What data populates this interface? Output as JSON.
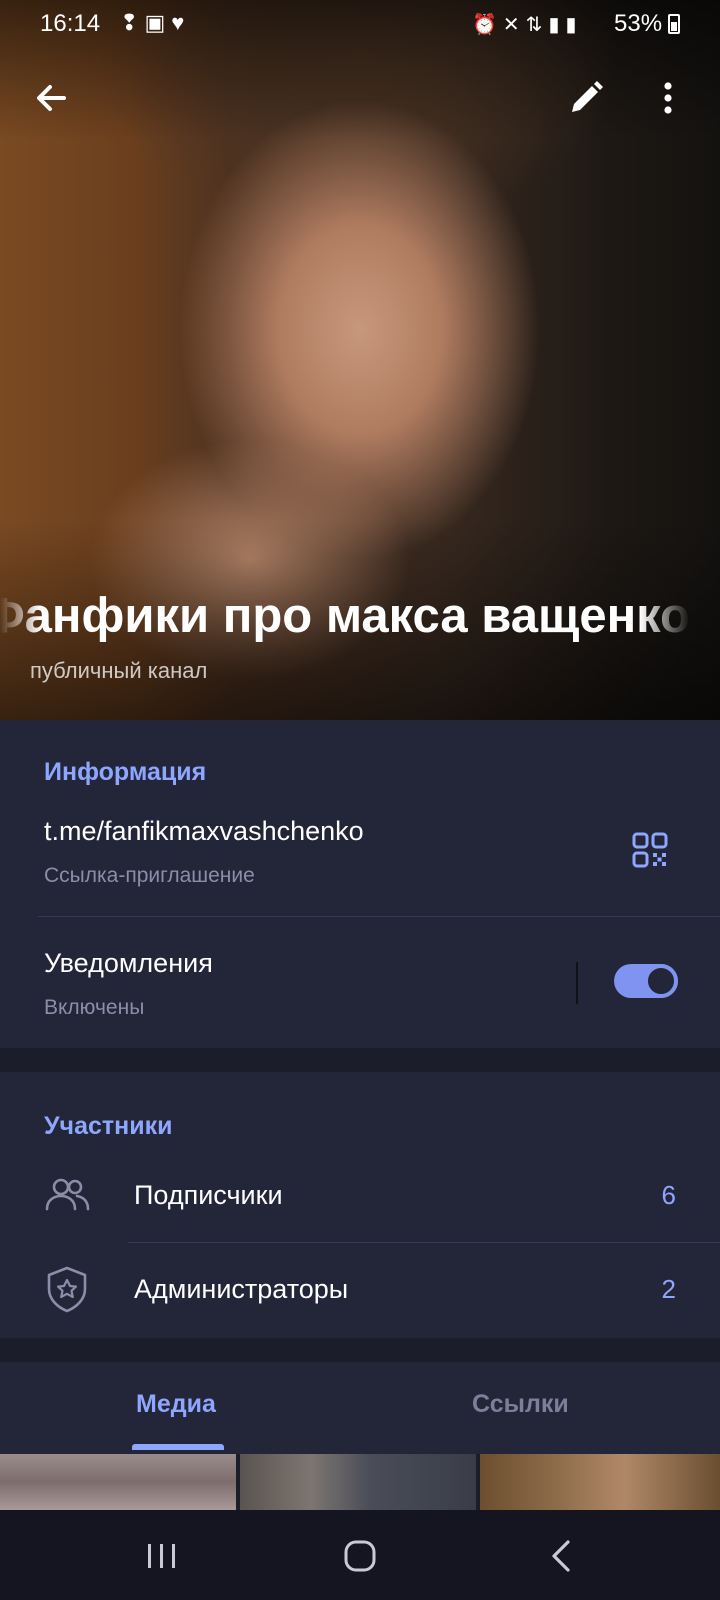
{
  "status_bar": {
    "time": "16:14",
    "left_icons": [
      "footsteps-icon",
      "twitch-icon",
      "heart-icon"
    ],
    "right_icons": [
      "alarm-icon",
      "mute-icon",
      "4g-icon",
      "signal-icon",
      "signal-icon"
    ],
    "battery": "53%"
  },
  "header": {
    "channel_title": "Фанфики про макса ващенко",
    "channel_type": "публичный канал",
    "actions": [
      "back-icon",
      "edit-icon",
      "more-icon"
    ]
  },
  "info": {
    "section_title": "Информация",
    "link": "t.me/fanfikmaxvashchenko",
    "link_caption": "Ссылка-приглашение",
    "notifications_label": "Уведомления",
    "notifications_status": "Включены",
    "notifications_enabled": true
  },
  "members": {
    "section_title": "Участники",
    "rows": [
      {
        "label": "Подписчики",
        "count": "6",
        "icon": "people-icon"
      },
      {
        "label": "Администраторы",
        "count": "2",
        "icon": "shield-star-icon"
      }
    ]
  },
  "tabs": {
    "items": [
      "Медиа",
      "Ссылки"
    ],
    "active": "Медиа"
  },
  "system_nav": [
    "recents-icon",
    "home-icon",
    "back-icon"
  ],
  "colors": {
    "accent": "#8fa6ff",
    "card": "#232538",
    "background": "#1b1d2b",
    "toggle": "#7f93f0"
  }
}
